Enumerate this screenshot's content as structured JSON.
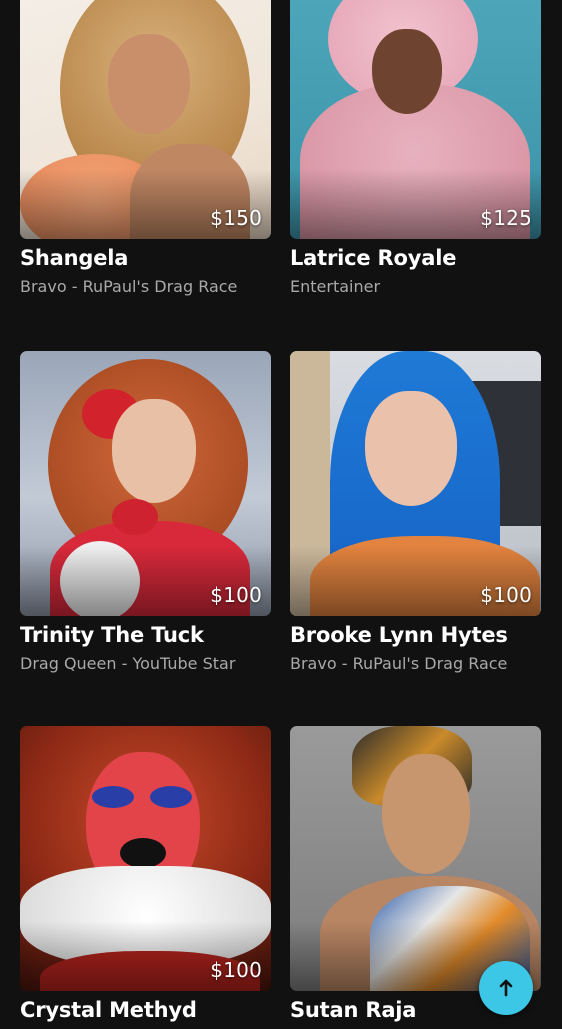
{
  "cards": [
    {
      "name": "Shangela",
      "subtitle": "Bravo - RuPaul's Drag Race",
      "price": "$150"
    },
    {
      "name": "Latrice Royale",
      "subtitle": "Entertainer",
      "price": "$125"
    },
    {
      "name": "Trinity The Tuck",
      "subtitle": "Drag Queen - YouTube Star",
      "price": "$100"
    },
    {
      "name": "Brooke Lynn Hytes",
      "subtitle": "Bravo - RuPaul's Drag Race",
      "price": "$100"
    },
    {
      "name": "Crystal Methyd",
      "subtitle": "",
      "price": "$100"
    },
    {
      "name": "Sutan Raja",
      "subtitle": "",
      "price": ""
    }
  ],
  "scroll_top": {
    "icon": "arrow-up-icon",
    "color": "#3cc7e6"
  },
  "colors": {
    "background": "#111111",
    "name": "#ffffff",
    "subtitle": "#a9a9a9"
  }
}
